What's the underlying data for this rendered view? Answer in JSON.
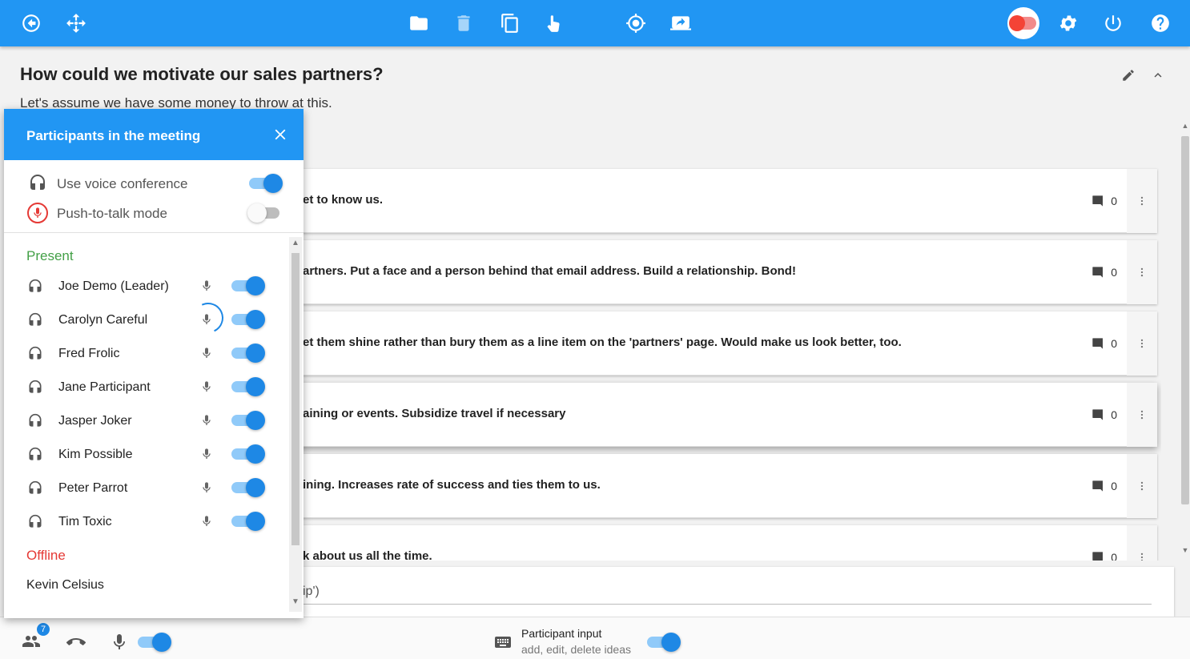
{
  "toolbar": {
    "icons": [
      "back-icon",
      "move-icon",
      "folder-icon",
      "trash-icon",
      "copy-icon",
      "pointer-icon",
      "target-icon",
      "share-screen-icon",
      "record-toggle",
      "gear-icon",
      "power-icon",
      "help-icon"
    ],
    "colors": {
      "primary": "#2196f3",
      "record": "#f44336"
    }
  },
  "question": {
    "title": "How could we motivate our sales partners?",
    "description": "Let's assume we have some money to throw at this."
  },
  "ideas": [
    {
      "text": "et to know us.",
      "comments": "0"
    },
    {
      "text": "artners. Put a face and a person behind that email address. Build a relationship. Bond!",
      "comments": "0"
    },
    {
      "text": "et them shine rather than bury them as a line item on the 'partners' page. Would make us look better, too.",
      "comments": "0"
    },
    {
      "text": "aining or events. Subsidize travel if necessary",
      "comments": "0"
    },
    {
      "text": "ining. Increases rate of success and ties them to us.",
      "comments": "0"
    },
    {
      "text": "k about us all the time.",
      "comments": "0"
    }
  ],
  "idea_input": {
    "placeholder": "ip')"
  },
  "panel": {
    "title": "Participants in the meeting",
    "voice_conference_label": "Use voice conference",
    "voice_conference_on": true,
    "push_to_talk_label": "Push-to-talk mode",
    "push_to_talk_on": false,
    "present_label": "Present",
    "offline_label": "Offline",
    "present": [
      {
        "name": "Joe Demo (Leader)",
        "speaking": false,
        "enabled": true
      },
      {
        "name": "Carolyn Careful",
        "speaking": true,
        "enabled": true
      },
      {
        "name": "Fred Frolic",
        "speaking": false,
        "enabled": true
      },
      {
        "name": "Jane Participant",
        "speaking": false,
        "enabled": true
      },
      {
        "name": "Jasper Joker",
        "speaking": false,
        "enabled": true
      },
      {
        "name": "Kim Possible",
        "speaking": false,
        "enabled": true
      },
      {
        "name": "Peter Parrot",
        "speaking": false,
        "enabled": true
      },
      {
        "name": "Tim Toxic",
        "speaking": false,
        "enabled": true
      }
    ],
    "offline": [
      "Kevin Celsius"
    ]
  },
  "bottombar": {
    "participants_badge": "7",
    "mic_on": true,
    "participant_input_label": "Participant input",
    "participant_input_sub": "add, edit, delete ideas",
    "participant_input_on": true
  }
}
